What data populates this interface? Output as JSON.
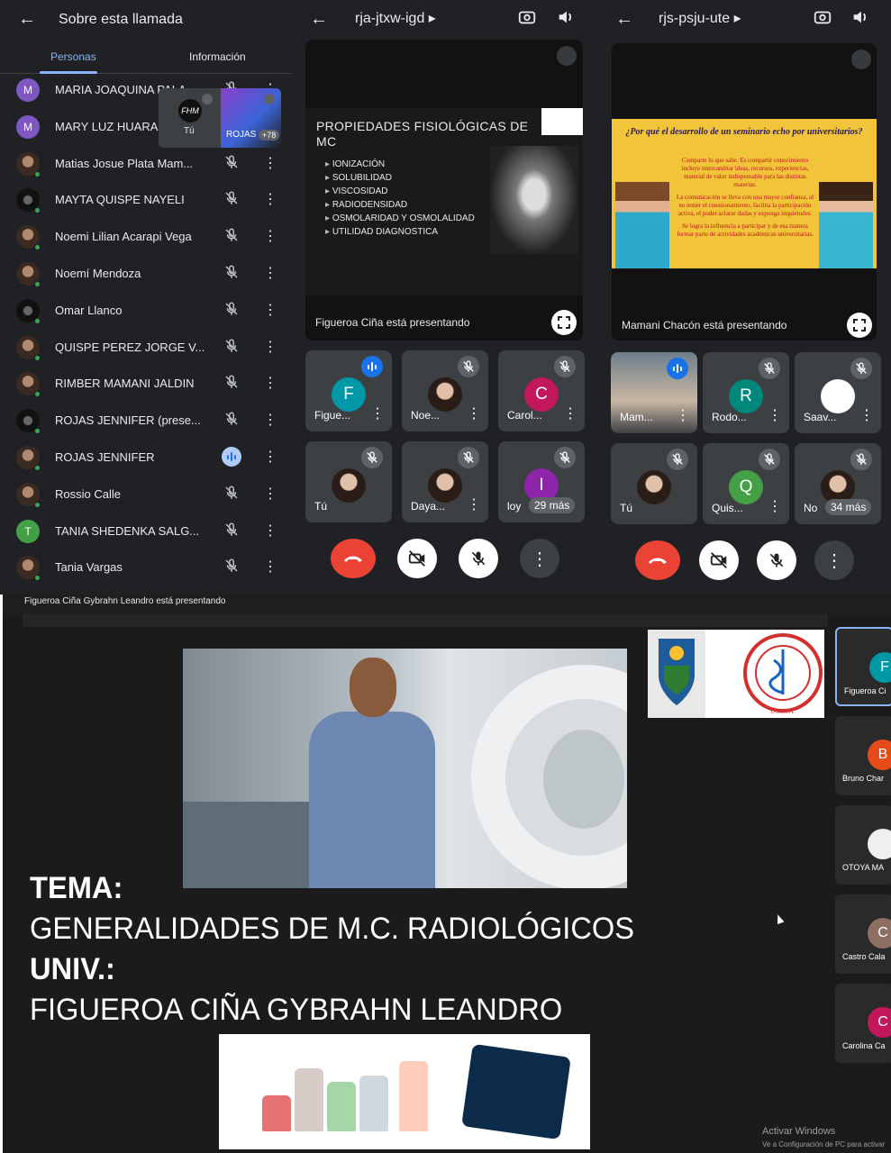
{
  "panel1": {
    "title": "Sobre esta llamada",
    "tabs": [
      "Personas",
      "Información"
    ],
    "floating": {
      "you_label": "Tú",
      "you_initials": "FHM",
      "share_label": "ROJAS",
      "share_count": "+78"
    },
    "participants": [
      {
        "name": "MARIA JOAQUINA PALA",
        "avatar": "M",
        "color": "#7e57c2",
        "mic": "muted"
      },
      {
        "name": "MARY LUZ HUARA",
        "avatar": "M",
        "color": "#7e57c2",
        "mic": "muted"
      },
      {
        "name": "Matias Josue Plata Mam...",
        "avatar": "",
        "color": "",
        "mic": "muted"
      },
      {
        "name": "MAYTA QUISPE NAYELI",
        "avatar": "",
        "color": "",
        "mic": "muted"
      },
      {
        "name": "Noemi Lilian Acarapi Vega",
        "avatar": "",
        "color": "",
        "mic": "muted"
      },
      {
        "name": "Noemí Mendoza",
        "avatar": "",
        "color": "",
        "mic": "muted"
      },
      {
        "name": "Omar Llanco",
        "avatar": "",
        "color": "",
        "mic": "muted"
      },
      {
        "name": "QUISPE PEREZ JORGE V...",
        "avatar": "",
        "color": "",
        "mic": "muted"
      },
      {
        "name": "RIMBER MAMANI JALDIN",
        "avatar": "",
        "color": "",
        "mic": "muted"
      },
      {
        "name": "ROJAS JENNIFER (prese...",
        "avatar": "",
        "color": "",
        "mic": "muted"
      },
      {
        "name": "ROJAS JENNIFER",
        "avatar": "",
        "color": "",
        "mic": "active"
      },
      {
        "name": "Rossio Calle",
        "avatar": "",
        "color": "",
        "mic": "muted"
      },
      {
        "name": "TANIA SHEDENKA SALG...",
        "avatar": "T",
        "color": "#43a047",
        "mic": "muted"
      },
      {
        "name": "Tania Vargas",
        "avatar": "",
        "color": "",
        "mic": "muted"
      }
    ]
  },
  "panel2": {
    "code": "rja-jtxw-igd",
    "presenting": "Figueroa Ciña está presentando",
    "slide_title": "PROPIEDADES FISIOLÓGICAS DE MC",
    "slide_items": [
      "IONIZACIÓN",
      "SOLUBILIDAD",
      "VISCOSIDAD",
      "RADIODENSIDAD",
      "OSMOLARIDAD Y OSMOLALIDAD",
      "UTILIDAD DIAGNOSTICA"
    ],
    "tiles": [
      {
        "name": "Figue...",
        "avatar": "F",
        "color": "#0097a7",
        "speaking": true
      },
      {
        "name": "Noe...",
        "avatar": "",
        "color": "",
        "speaking": false
      },
      {
        "name": "Carol...",
        "avatar": "C",
        "color": "#c2185b",
        "speaking": false
      },
      {
        "name": "Tú",
        "avatar": "",
        "color": "",
        "speaking": false
      },
      {
        "name": "Daya...",
        "avatar": "",
        "color": "",
        "speaking": false
      },
      {
        "name": "loy",
        "avatar": "I",
        "color": "#8e24aa",
        "speaking": false,
        "count": "29 más"
      }
    ]
  },
  "panel3": {
    "code": "rjs-psju-ute",
    "presenting": "Mamani Chacón está presentando",
    "slide_heading": "¿Por qué el desarrollo de un seminario echo por universitarios?",
    "slide_paragraphs": [
      "Comparte lo que sabe. Es compartir conocimiento incluye intercambiar ideas, recursos, experiencias, material de valor indispensable para las distintas materias.",
      "La comunicación se lleva con una mayor confianza, al no temer el cuestionamiento, facilita la participación activa, el poder aclarar dudas y exponga inquietudes.",
      "Se logra la influencia a participar y de esa manera formar parte de actividades académicas universitarias."
    ],
    "tiles": [
      {
        "name": "Mam...",
        "avatar": "",
        "color": "",
        "speaking": true
      },
      {
        "name": "Rodo...",
        "avatar": "R",
        "color": "#00897b",
        "speaking": false
      },
      {
        "name": "Saav...",
        "avatar": "",
        "color": "#ffffff",
        "speaking": false
      },
      {
        "name": "Tú",
        "avatar": "",
        "color": "",
        "speaking": false
      },
      {
        "name": "Quis...",
        "avatar": "Q",
        "color": "#43a047",
        "speaking": false
      },
      {
        "name": "No",
        "avatar": "",
        "color": "",
        "speaking": false,
        "count": "34 más"
      }
    ]
  },
  "panel4": {
    "presenting": "Figueroa Ciña Gybrahn Leandro está presentando",
    "tema_label": "TEMA:",
    "tema_value": "GENERALIDADES DE M.C. RADIOLÓGICOS",
    "univ_label": "UNIV.:",
    "univ_value": "FIGUEROA CIÑA GYBRAHN LEANDRO",
    "logo_text": "FACULTAD DE MEDICINA",
    "logo_sub": "U.M.S.A.",
    "side_tiles": [
      {
        "name": "Figueroa Ci",
        "avatar": "F",
        "color": "#0097a7",
        "selected": true
      },
      {
        "name": "Bruno Char",
        "avatar": "B",
        "color": "#e64a19",
        "selected": false
      },
      {
        "name": "OTOYA MA",
        "avatar": "",
        "color": "#efefef",
        "selected": false
      },
      {
        "name": "Castro Cala",
        "avatar": "C",
        "color": "#8d6e63",
        "selected": false
      },
      {
        "name": "Carolina Ca",
        "avatar": "C",
        "color": "#c2185b",
        "selected": false
      }
    ],
    "watermark": "Activar Windows",
    "watermark_sub": "Ve a Configuración de PC para activar"
  }
}
